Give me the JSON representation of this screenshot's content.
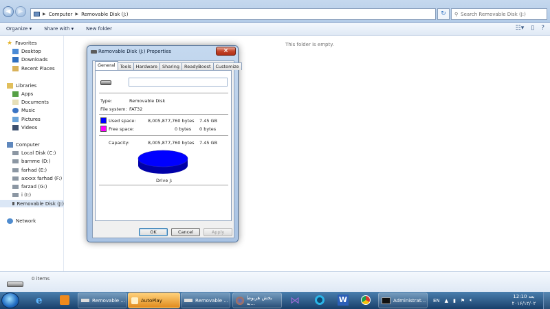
{
  "address": {
    "crumbs": [
      "Computer",
      "Removable Disk (J:)"
    ],
    "search_placeholder": "Search Removable Disk (J:)"
  },
  "toolbar": {
    "organize": "Organize",
    "share_with": "Share with",
    "new_folder": "New folder"
  },
  "nav": {
    "favorites_label": "Favorites",
    "favorites": [
      "Desktop",
      "Downloads",
      "Recent Places"
    ],
    "libraries_label": "Libraries",
    "libraries": [
      "Apps",
      "Documents",
      "Music",
      "Pictures",
      "Videos"
    ],
    "computer_label": "Computer",
    "drives": [
      "Local Disk (C:)",
      "barnme (D:)",
      "farhad (E:)",
      "axxxx farhad (F:)",
      "farzad (G:)",
      "i (I:)",
      "Removable Disk (J:)"
    ],
    "network_label": "Network"
  },
  "main": {
    "empty_text": "This folder is empty."
  },
  "details": {
    "item_count": "0 items"
  },
  "dialog": {
    "title": "Removable Disk (J:) Properties",
    "close_glyph": "×",
    "tabs": [
      "General",
      "Tools",
      "Hardware",
      "Sharing",
      "ReadyBoost",
      "Customize"
    ],
    "volume_name": "",
    "type_label": "Type:",
    "type_value": "Removable Disk",
    "fs_label": "File system:",
    "fs_value": "FAT32",
    "used_label": "Used space:",
    "used_bytes": "8,005,877,760 bytes",
    "used_gb": "7.45 GB",
    "free_label": "Free space:",
    "free_bytes": "0 bytes",
    "free_gb": "0 bytes",
    "capacity_label": "Capacity:",
    "capacity_bytes": "8,005,877,760 bytes",
    "capacity_gb": "7.45 GB",
    "drive_label": "Drive J:",
    "used_color": "#0000ff",
    "free_color": "#ff00ff",
    "used_fraction": 1.0,
    "ok": "OK",
    "cancel": "Cancel",
    "apply": "Apply"
  },
  "taskbar": {
    "tasks": [
      "Removable ...",
      "AutoPlay",
      "Removable ...",
      "بخش هربوط به...",
      "Administrat..."
    ],
    "lang": "EN",
    "time": "12:10 بعد",
    "date": "۲۰۱۶/۱۲/۰۲"
  }
}
